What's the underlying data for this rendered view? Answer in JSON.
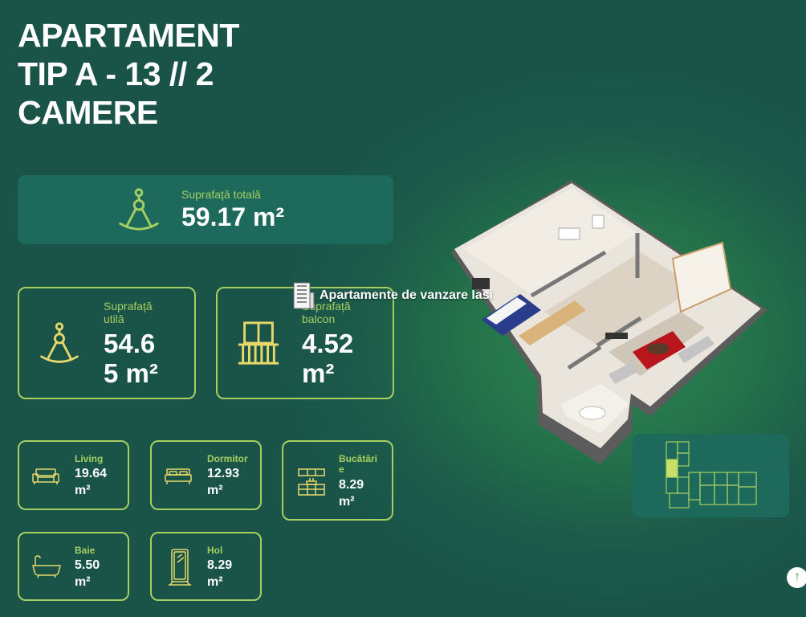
{
  "title": {
    "line1": "APARTAMENT",
    "line2": "TIP A - 13 // 2",
    "line3": "CAMERE"
  },
  "total_area": {
    "label": "Suprafață totală",
    "value": "59.17 m²",
    "icon": "compass-icon"
  },
  "usable_area": {
    "label_1": "Suprafață",
    "label_2": "utilă",
    "value_1": "54.6",
    "value_2": "5 m²",
    "icon": "compass-icon"
  },
  "balcony_area": {
    "label_1": "Suprafață",
    "label_2": "balcon",
    "value_1": "4.52",
    "value_2": "m²",
    "icon": "balcony-icon"
  },
  "rooms": {
    "living": {
      "label": "Living",
      "value_1": "19.64",
      "value_2": "m²",
      "icon": "sofa-icon"
    },
    "bedroom": {
      "label": "Dormitor",
      "value_1": "12.93",
      "value_2": "m²",
      "icon": "bed-icon"
    },
    "kitchen": {
      "label_1": "Bucătări",
      "label_2": "e",
      "value_1": "8.29",
      "value_2": "m²",
      "icon": "kitchen-icon"
    },
    "bathroom": {
      "label": "Baie",
      "value_1": "5.50",
      "value_2": "m²",
      "icon": "bathtub-icon"
    },
    "hall": {
      "label": "Hol",
      "value_1": "8.29",
      "value_2": "m²",
      "icon": "mirror-icon"
    }
  },
  "watermark": {
    "text": "Apartamente de vanzare Iasi",
    "icon": "building-icon"
  },
  "scroll_top": {
    "icon": "arrow-up-icon",
    "glyph": "↑"
  },
  "colors": {
    "accent": "#a6cf62",
    "card_bg": "#1d6a5c",
    "bg_dark": "#1a5449",
    "bg_light": "#2f8a52"
  }
}
